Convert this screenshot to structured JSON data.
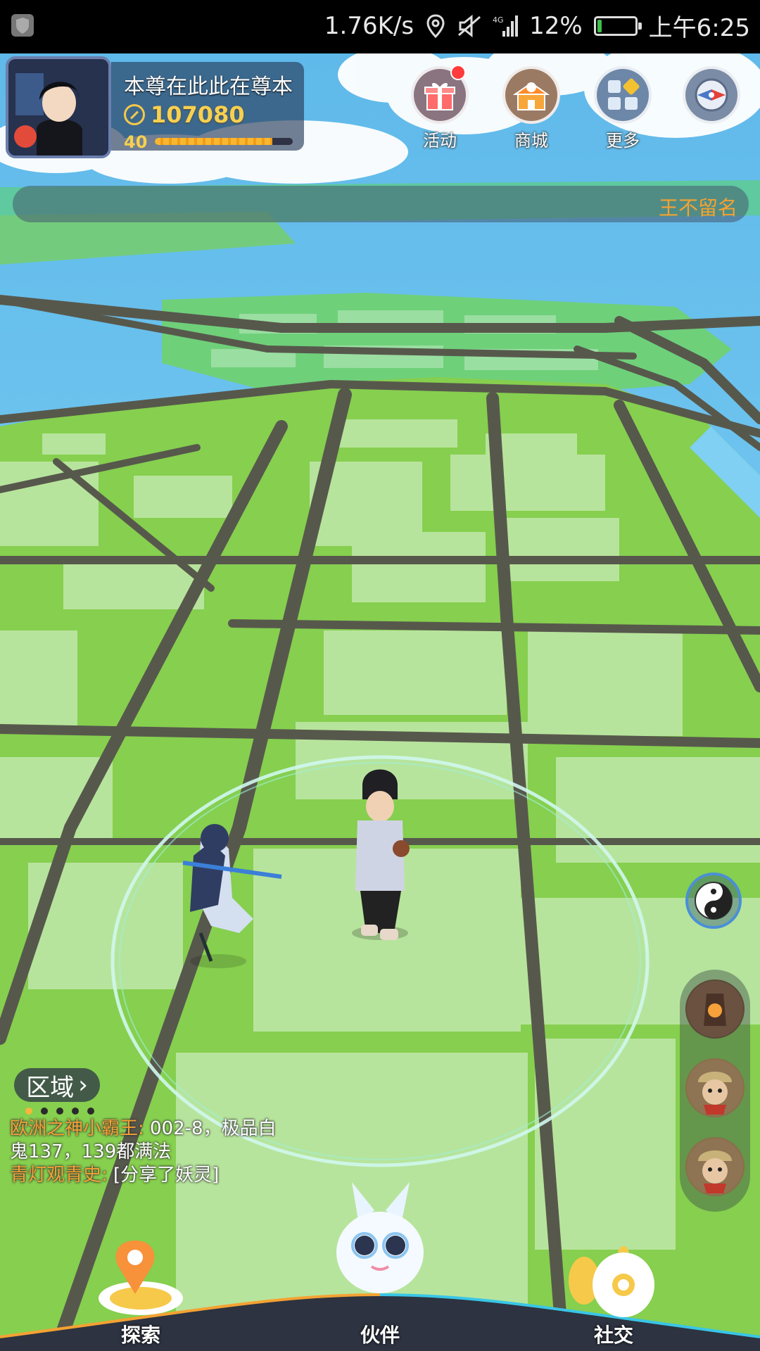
{
  "status_bar": {
    "speed": "1.76K/s",
    "network": "4G",
    "battery": "12%",
    "battery_level": 0.12,
    "time": "上午6:25"
  },
  "player": {
    "name": "本尊在此此在尊本",
    "power": "107080",
    "level": "40",
    "xp_fraction": 0.85
  },
  "top_buttons": [
    {
      "label": "活动",
      "icon": "gift-icon",
      "has_badge": true
    },
    {
      "label": "商城",
      "icon": "shop-icon"
    },
    {
      "label": "更多",
      "icon": "grid-icon"
    },
    {
      "label": "",
      "icon": "compass-icon"
    }
  ],
  "marquee": {
    "text": "王不留名"
  },
  "region": {
    "label": "区域"
  },
  "chat": [
    {
      "who": "欧洲之神小霸王:",
      "msg": " 002-8，极品白"
    },
    {
      "who": "",
      "msg": "鬼137，139都满法"
    },
    {
      "who": "青灯观青史:",
      "msg": " [分享了妖灵]"
    }
  ],
  "bottom_nav": [
    {
      "label": "探索",
      "icon": "map-pin-icon"
    },
    {
      "label": "伙伴",
      "icon": "spirit-icon"
    },
    {
      "label": "社交",
      "icon": "social-icon"
    }
  ],
  "colors": {
    "water": "#7fd0f2",
    "land": "#8ad24f",
    "road": "#5a5a4e",
    "building": "#b6e39a",
    "accent": "#f4a233"
  }
}
